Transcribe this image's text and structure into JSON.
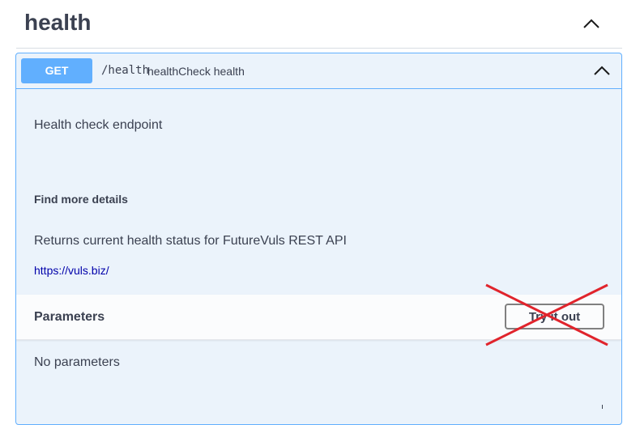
{
  "tag": {
    "title": "health",
    "toggle_icon": "chevron-up-icon"
  },
  "operation": {
    "method": "GET",
    "path": "/health",
    "summary": "healthCheck health",
    "method_color": "#61affe",
    "toggle_icon": "chevron-up-icon",
    "description": "Health check endpoint",
    "external_docs": {
      "heading": "Find more details",
      "text": "Returns current health status for FutureVuls REST API",
      "link": "https://vuls.biz/"
    },
    "parameters": {
      "title": "Parameters",
      "try_label": "Try it out",
      "empty_text": "No parameters"
    }
  },
  "annotation": {
    "cross_color": "#e0242c"
  }
}
